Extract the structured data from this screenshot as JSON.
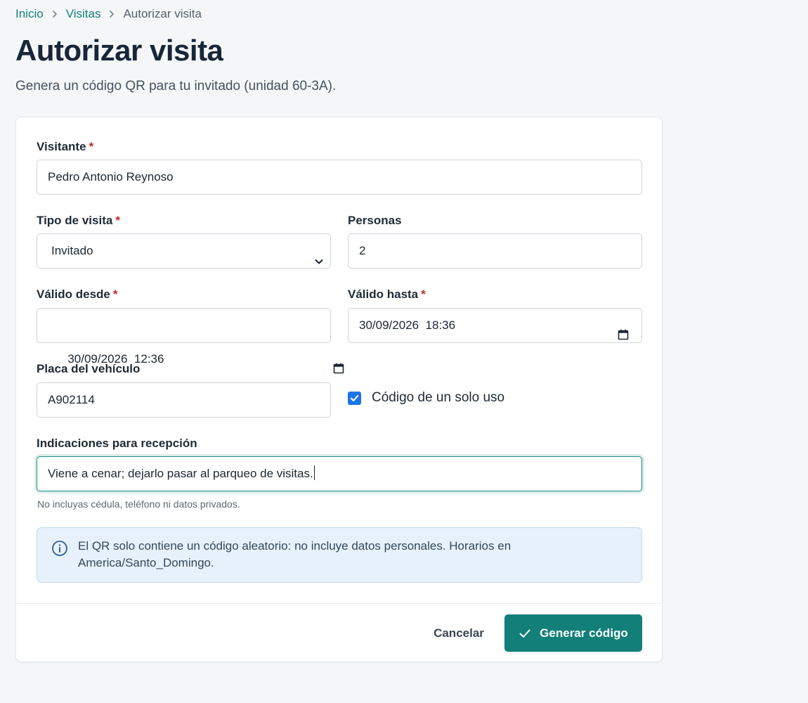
{
  "breadcrumb": {
    "items": [
      {
        "label": "Inicio"
      },
      {
        "label": "Visitas"
      },
      {
        "label": "Autorizar visita"
      }
    ],
    "separator_icon": "chevron-right-icon"
  },
  "header": {
    "title": "Autorizar visita",
    "subtitle": "Genera un código QR para tu invitado (unidad 60-3A)."
  },
  "form": {
    "visitor": {
      "label": "Visitante",
      "required_mark": "*",
      "value": "Pedro Antonio Reynoso"
    },
    "visit_type": {
      "label": "Tipo de visita",
      "required_mark": "*",
      "value": "Invitado",
      "icon": "chevron-down-icon"
    },
    "people": {
      "label": "Personas",
      "value": "2"
    },
    "valid_from": {
      "label": "Válido desde",
      "required_mark": "*",
      "value": "30/09/2026  12:36",
      "icon": "calendar-icon"
    },
    "valid_until": {
      "label": "Válido hasta",
      "required_mark": "*",
      "value": "30/09/2026  18:36",
      "icon": "calendar-icon"
    },
    "plate": {
      "label": "Placa del vehículo",
      "value": "A902114"
    },
    "single_use": {
      "label": "Código de un solo uso",
      "checked": true
    },
    "notes": {
      "label": "Indicaciones para recepción",
      "value": "Viene a cenar; dejarlo pasar al parqueo de visitas.",
      "helper": "No incluyas cédula, teléfono ni datos privados."
    }
  },
  "info": {
    "icon": "info-icon",
    "text": "El QR solo contiene un código aleatorio: no incluye datos personales. Horarios en America/Santo_Domingo."
  },
  "actions": {
    "cancel_label": "Cancelar",
    "submit_label": "Generar código",
    "submit_icon": "check-icon"
  },
  "colors": {
    "accent": "#137f79",
    "checkbox": "#1a73e8",
    "required": "#c62828",
    "info_bg": "#e7f1fb"
  }
}
